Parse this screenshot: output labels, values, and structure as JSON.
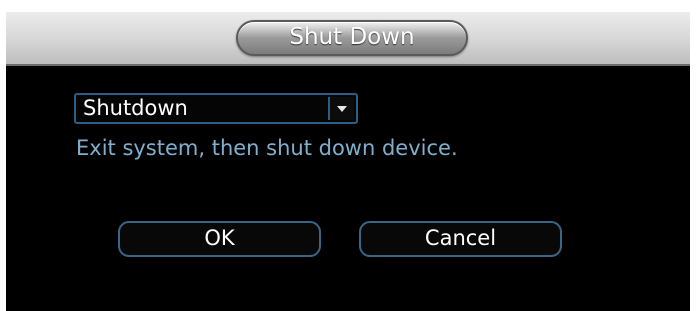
{
  "dialog": {
    "title": "Shut Down",
    "mode_select": {
      "value": "Shutdown"
    },
    "description": "Exit system, then shut down device.",
    "buttons": {
      "ok_label": "OK",
      "cancel_label": "Cancel"
    }
  },
  "icons": {
    "dropdown": "chevron-down-icon"
  },
  "colors": {
    "dialog_background": "#000000",
    "title_text": "#ffffff",
    "description_text": "#7fb0cf",
    "control_border": "#2e5e84"
  }
}
